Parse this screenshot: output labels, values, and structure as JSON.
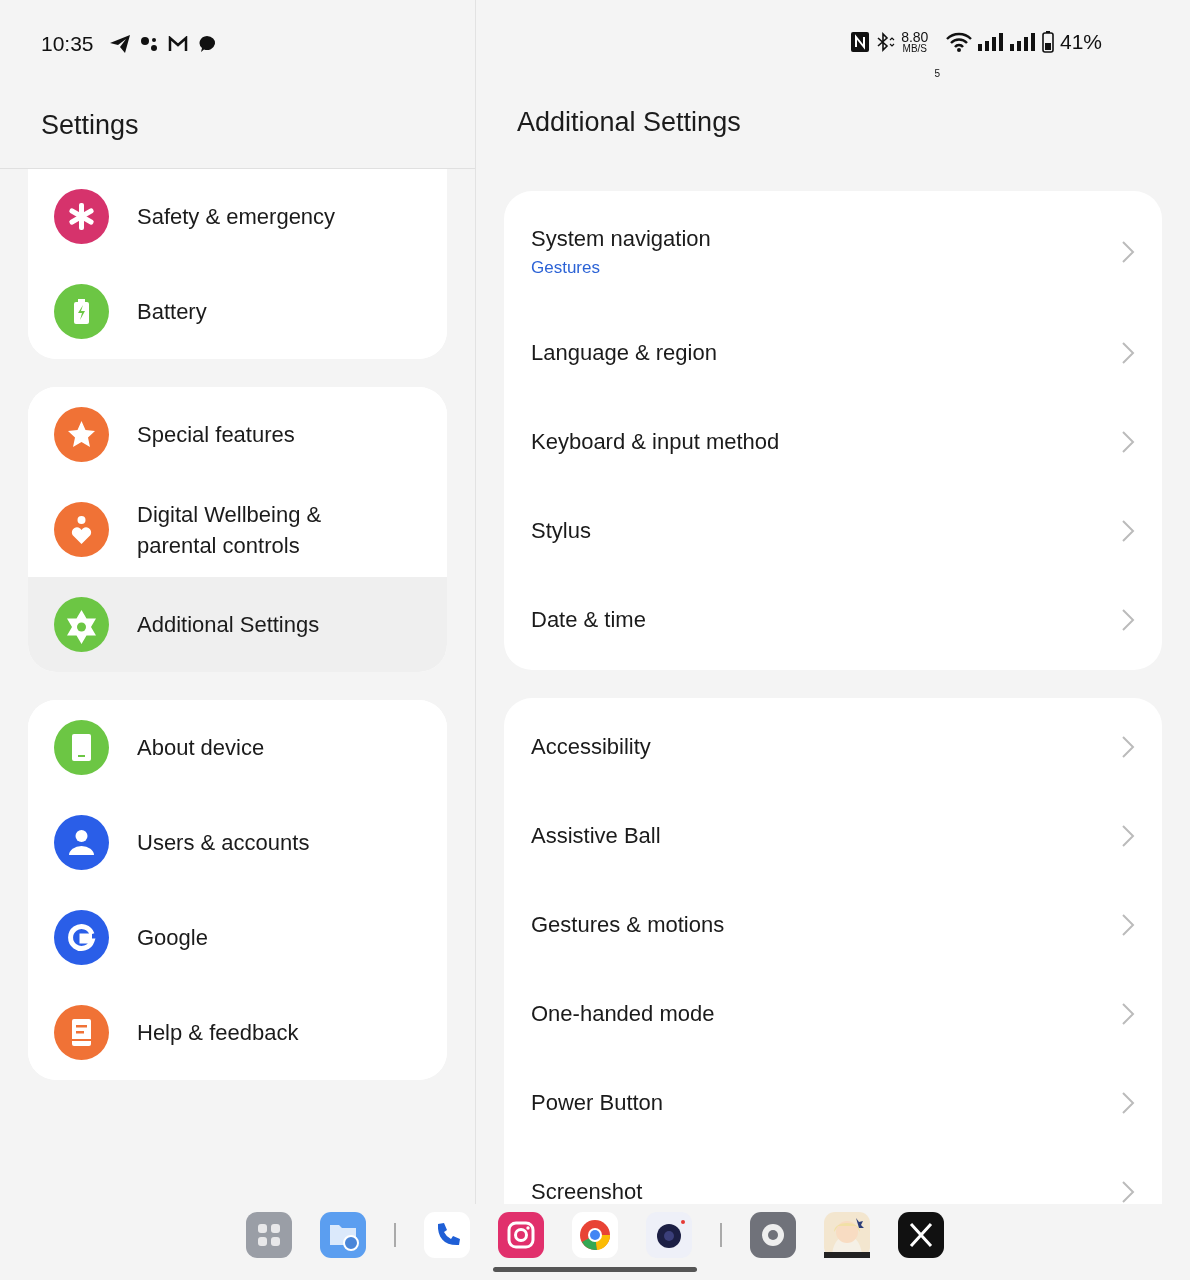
{
  "status_bar": {
    "time": "10:35",
    "speed_value": "8.80",
    "speed_unit": "MB/S",
    "wifi_band": "5",
    "battery": "41%"
  },
  "sidebar": {
    "title": "Settings",
    "groups": [
      {
        "items": [
          {
            "label": "Safety & emergency",
            "kind": "asterisk",
            "color": "#d6336c",
            "selected": false
          },
          {
            "label": "Battery",
            "kind": "battery",
            "color": "#6cc644",
            "selected": false
          }
        ]
      },
      {
        "items": [
          {
            "label": "Special features",
            "kind": "star",
            "color": "#f07236",
            "selected": false
          },
          {
            "label": "Digital Wellbeing & parental controls",
            "kind": "heart",
            "color": "#f07236",
            "selected": false
          },
          {
            "label": "Additional Settings",
            "kind": "gear",
            "color": "#6cc644",
            "selected": true
          }
        ]
      },
      {
        "items": [
          {
            "label": "About device",
            "kind": "device",
            "color": "#6cc644",
            "selected": false
          },
          {
            "label": "Users & accounts",
            "kind": "person",
            "color": "#2a5ee8",
            "selected": false
          },
          {
            "label": "Google",
            "kind": "google",
            "color": "#2a5ee8",
            "selected": false
          },
          {
            "label": "Help & feedback",
            "kind": "book",
            "color": "#f07236",
            "selected": false
          }
        ]
      }
    ]
  },
  "detail": {
    "title": "Additional Settings",
    "groups": [
      {
        "items": [
          {
            "label": "System navigation",
            "subtitle": "Gestures"
          },
          {
            "label": "Language & region"
          },
          {
            "label": "Keyboard & input method"
          },
          {
            "label": "Stylus"
          },
          {
            "label": "Date & time"
          }
        ]
      },
      {
        "items": [
          {
            "label": "Accessibility"
          },
          {
            "label": "Assistive Ball"
          },
          {
            "label": "Gestures & motions"
          },
          {
            "label": "One-handed mode"
          },
          {
            "label": "Power Button"
          },
          {
            "label": "Screenshot"
          }
        ]
      }
    ]
  }
}
